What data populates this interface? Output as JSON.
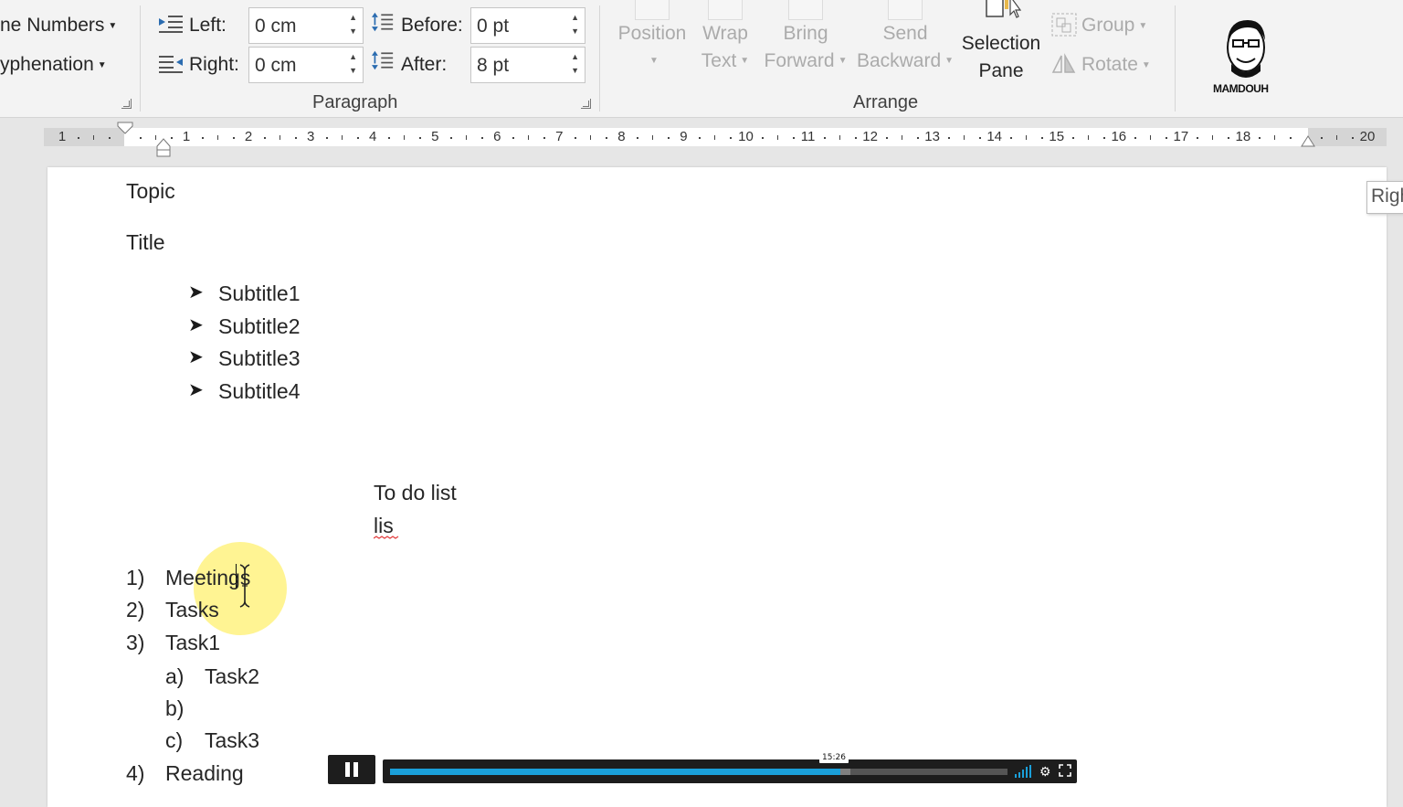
{
  "ribbon": {
    "page_setup": {
      "line_numbers": "ne Numbers",
      "hyphenation": "yphenation"
    },
    "paragraph": {
      "left_label": "Left:",
      "left_value": "0 cm",
      "right_label": "Right:",
      "right_value": "0 cm",
      "before_label": "Before:",
      "before_value": "0 pt",
      "after_label": "After:",
      "after_value": "8 pt",
      "group_label": "Paragraph"
    },
    "arrange": {
      "position": "Position",
      "wrap_text_1": "Wrap",
      "wrap_text_2": "Text",
      "bring_forward_1": "Bring",
      "bring_forward_2": "Forward",
      "send_backward_1": "Send",
      "send_backward_2": "Backward",
      "selection_pane_1": "Selection",
      "selection_pane_2": "Pane",
      "group": "Group",
      "rotate": "Rotate",
      "group_label": "Arrange"
    },
    "logo_text": "MAMDOUH"
  },
  "ruler": {
    "left_numbers": [
      "1"
    ],
    "numbers": [
      "1",
      "2",
      "3",
      "4",
      "5",
      "6",
      "7",
      "8",
      "9",
      "10",
      "11",
      "12",
      "13",
      "14",
      "15",
      "16",
      "17",
      "18",
      "20"
    ]
  },
  "document": {
    "topic": "Topic",
    "title": "Title",
    "subtitles": [
      "Subtitle1",
      "Subtitle2",
      "Subtitle3",
      "Subtitle4"
    ],
    "todo_heading": "To do list",
    "todo_sub": "lis",
    "numbered": [
      {
        "marker": "1)",
        "text": "Meetings"
      },
      {
        "marker": "2)",
        "text": "Tasks"
      },
      {
        "marker": "3)",
        "text": "Task1"
      },
      {
        "marker": "4)",
        "text": "Reading"
      }
    ],
    "lettered": [
      {
        "marker": "a)",
        "text": "Task2"
      },
      {
        "marker": "b)",
        "text": ""
      },
      {
        "marker": "c)",
        "text": "Task3"
      }
    ],
    "tooltip_partial": "Righ"
  },
  "player": {
    "timestamp": "15:26",
    "progress_fraction": 0.73,
    "accent": "#1a9fd9"
  }
}
